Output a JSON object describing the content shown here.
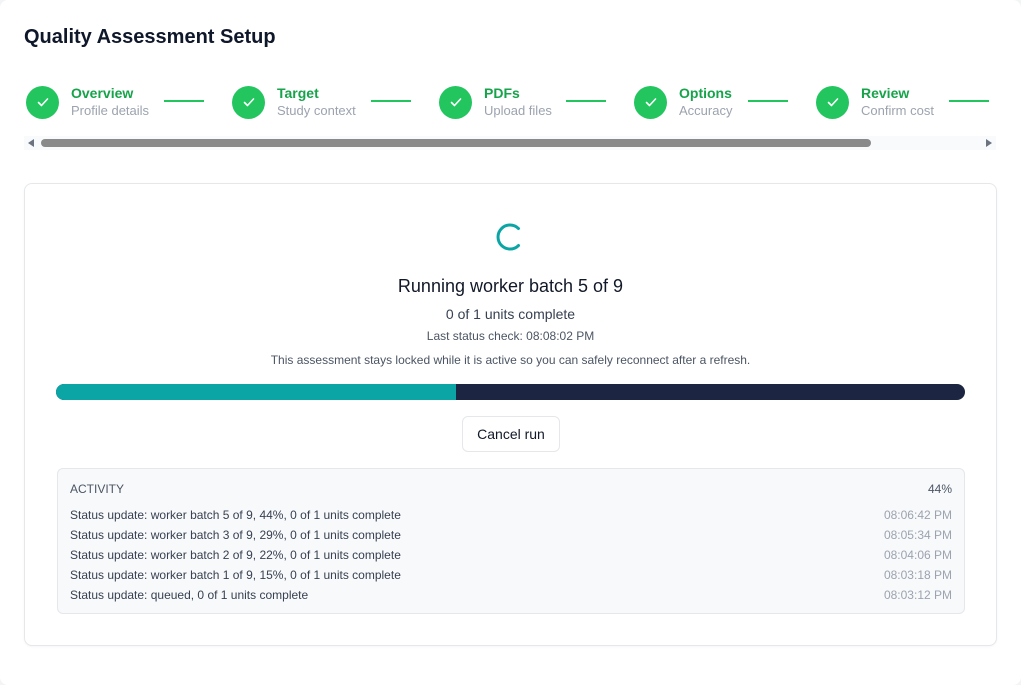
{
  "window": {
    "title": "Quality Assessment Setup"
  },
  "stepper": {
    "steps": [
      {
        "label": "Overview",
        "sub": "Profile details"
      },
      {
        "label": "Target",
        "sub": "Study context"
      },
      {
        "label": "PDFs",
        "sub": "Upload files"
      },
      {
        "label": "Options",
        "sub": "Accuracy"
      },
      {
        "label": "Review",
        "sub": "Confirm cost"
      }
    ]
  },
  "run": {
    "title": "Running worker batch 5 of 9",
    "units": "0 of 1 units complete",
    "last_check": "Last status check: 08:08:02 PM",
    "note": "This assessment stays locked while it is active so you can safely reconnect after a refresh.",
    "progress_fraction": 0.44,
    "cancel_label": "Cancel run"
  },
  "activity": {
    "heading": "ACTIVITY",
    "percent": "44%",
    "rows": [
      {
        "message": "Status update: worker batch 5 of 9, 44%, 0 of 1 units complete",
        "time": "08:06:42 PM"
      },
      {
        "message": "Status update: worker batch 3 of 9, 29%, 0 of 1 units complete",
        "time": "08:05:34 PM"
      },
      {
        "message": "Status update: worker batch 2 of 9, 22%, 0 of 1 units complete",
        "time": "08:04:06 PM"
      },
      {
        "message": "Status update: worker batch 1 of 9, 15%, 0 of 1 units complete",
        "time": "08:03:18 PM"
      },
      {
        "message": "Status update: queued, 0 of 1 units complete",
        "time": "08:03:12 PM"
      }
    ]
  },
  "colors": {
    "step_complete": "#22c55e",
    "progress_fill": "#0ca5a5",
    "progress_track": "#1c2541",
    "spinner": "#0ca5a5"
  },
  "icons": {
    "step_check": "check-icon",
    "loading": "spinner-icon"
  }
}
